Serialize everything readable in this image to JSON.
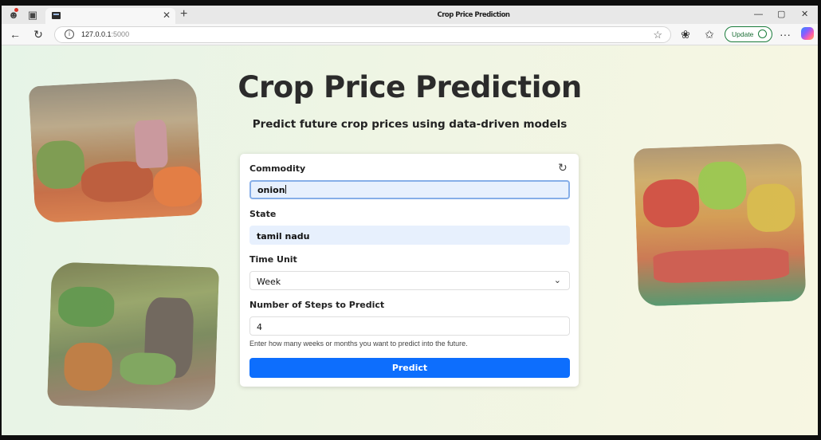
{
  "browser": {
    "tab_title": "Crop Price Prediction",
    "tab_close": "✕",
    "new_tab": "+",
    "win_minimize": "—",
    "win_restore": "▢",
    "win_close": "✕",
    "url_host": "127.0.0.1",
    "url_port": ":5000",
    "update_label": "Update",
    "more": "···"
  },
  "page": {
    "title": "Crop Price Prediction",
    "subtitle": "Predict future crop prices using data-driven models"
  },
  "form": {
    "commodity_label": "Commodity",
    "commodity_value": "onion",
    "state_label": "State",
    "state_value": "tamil nadu",
    "time_unit_label": "Time Unit",
    "time_unit_value": "Week",
    "steps_label": "Number of Steps to Predict",
    "steps_value": "4",
    "help_text": "Enter how many weeks or months you want to predict into the future.",
    "predict_label": "Predict"
  },
  "icons": {
    "back": "back-arrow-icon",
    "reload": "reload-icon",
    "info": "info-icon",
    "star": "star-icon",
    "extensions": "extensions-icon",
    "favorites": "favorites-icon",
    "form_reset": "refresh-icon",
    "select": "chevron-down-icon"
  },
  "colors": {
    "primary": "#0d6efd",
    "input_fill": "#e7f0fd",
    "update_green": "#1b7d3c"
  }
}
